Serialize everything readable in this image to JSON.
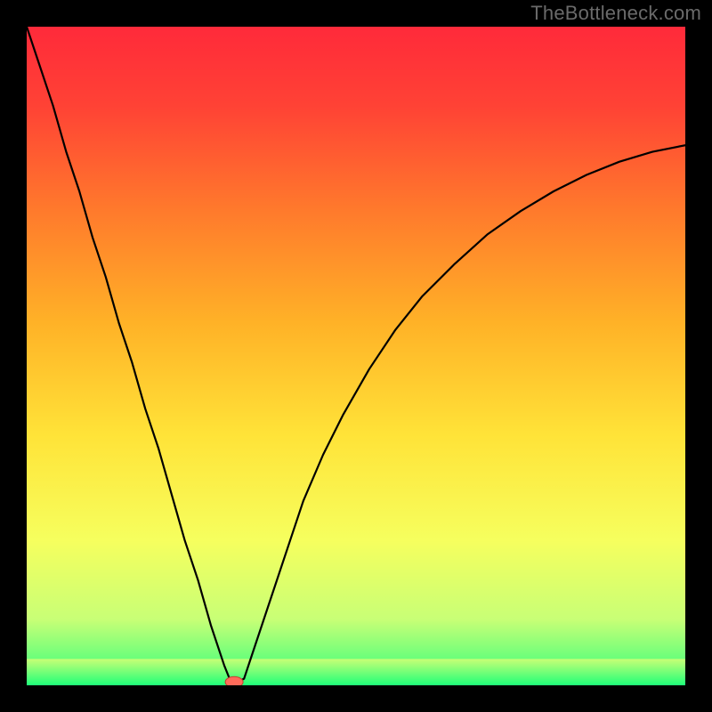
{
  "watermark": "TheBottleneck.com",
  "chart_data": {
    "type": "line",
    "title": "",
    "xlabel": "",
    "ylabel": "",
    "xlim": [
      0,
      100
    ],
    "ylim": [
      0,
      100
    ],
    "x": [
      0,
      2,
      4,
      6,
      8,
      10,
      12,
      14,
      16,
      18,
      20,
      22,
      24,
      26,
      28,
      30,
      31,
      32,
      33,
      34,
      36,
      38,
      40,
      42,
      45,
      48,
      52,
      56,
      60,
      65,
      70,
      75,
      80,
      85,
      90,
      95,
      100
    ],
    "values": [
      100,
      94,
      88,
      81,
      75,
      68,
      62,
      55,
      49,
      42,
      36,
      29,
      22,
      16,
      9,
      3,
      0.5,
      0.5,
      1,
      4,
      10,
      16,
      22,
      28,
      35,
      41,
      48,
      54,
      59,
      64,
      68.5,
      72,
      75,
      77.5,
      79.5,
      81,
      82
    ],
    "marker": {
      "x": 31.5,
      "y": 0.5
    },
    "green_band": {
      "y_top": 4,
      "y_bottom": 0
    }
  }
}
